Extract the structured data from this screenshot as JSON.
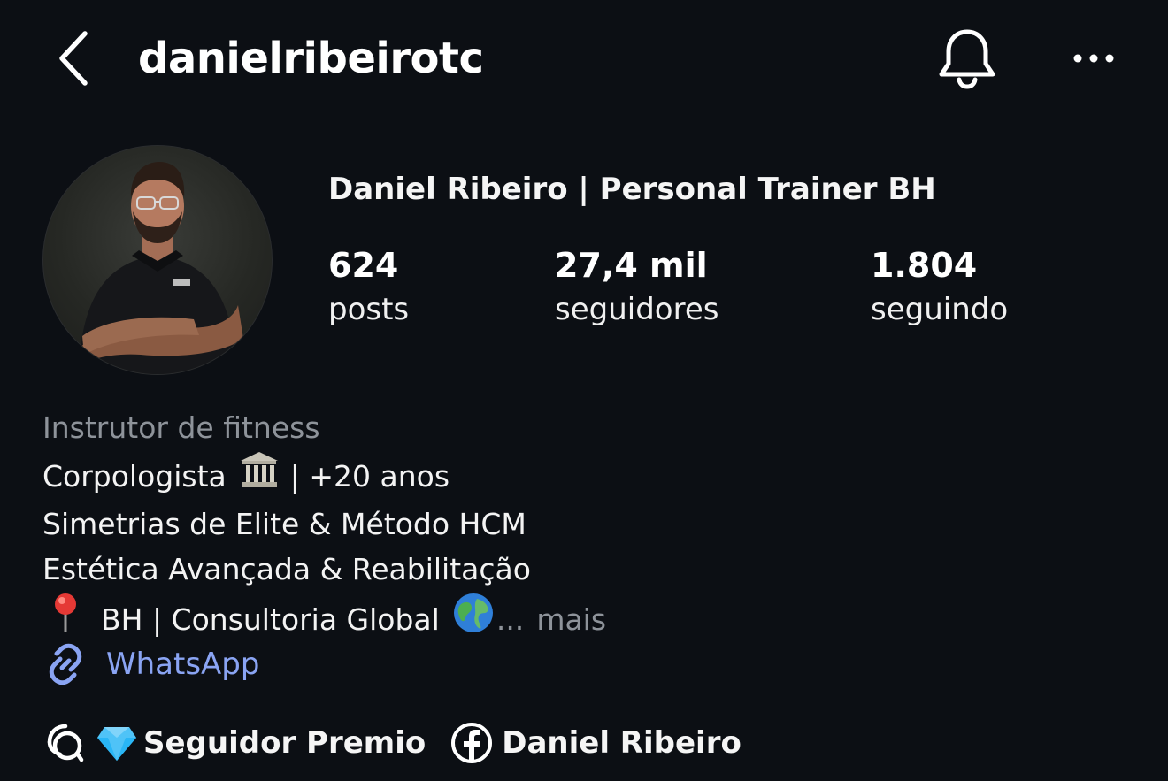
{
  "header": {
    "username": "danielribeirotc",
    "back_icon": "chevron-left-icon",
    "bell_icon": "bell-icon",
    "more_icon": "more-horizontal-icon"
  },
  "profile": {
    "display_name": "Daniel Ribeiro | Personal Trainer BH",
    "avatar": "profile-photo"
  },
  "stats": [
    {
      "value": "624",
      "label": "posts"
    },
    {
      "value": "27,4 mil",
      "label": "seguidores"
    },
    {
      "value": "1.804",
      "label": "seguindo"
    }
  ],
  "bio": {
    "category": "Instrutor de fitness",
    "line1_text": "Corpologista",
    "line1_emoji": "classical-building-emoji",
    "line1_suffix": "| +20 anos",
    "line2": "Simetrias de Elite & Método HCM",
    "line3": "Estética Avançada & Reabilitação",
    "line4_pin": "round-pushpin-emoji",
    "line4_text": "BH | Consultoria Global",
    "line4_globe": "globe-emoji",
    "ellipsis": "...",
    "more_label": "mais"
  },
  "link": {
    "icon": "link-icon",
    "label": "WhatsApp",
    "color": "#8aa4f3"
  },
  "social": {
    "threads_icon": "threads-icon",
    "diamond_icon": "gem-emoji",
    "threads_label": "Seguidor Premio",
    "facebook_icon": "facebook-icon",
    "facebook_label": "Daniel Ribeiro"
  },
  "colors": {
    "background": "#0c0f14",
    "muted_text": "#8e939a",
    "link_blue": "#8aa4f3"
  }
}
